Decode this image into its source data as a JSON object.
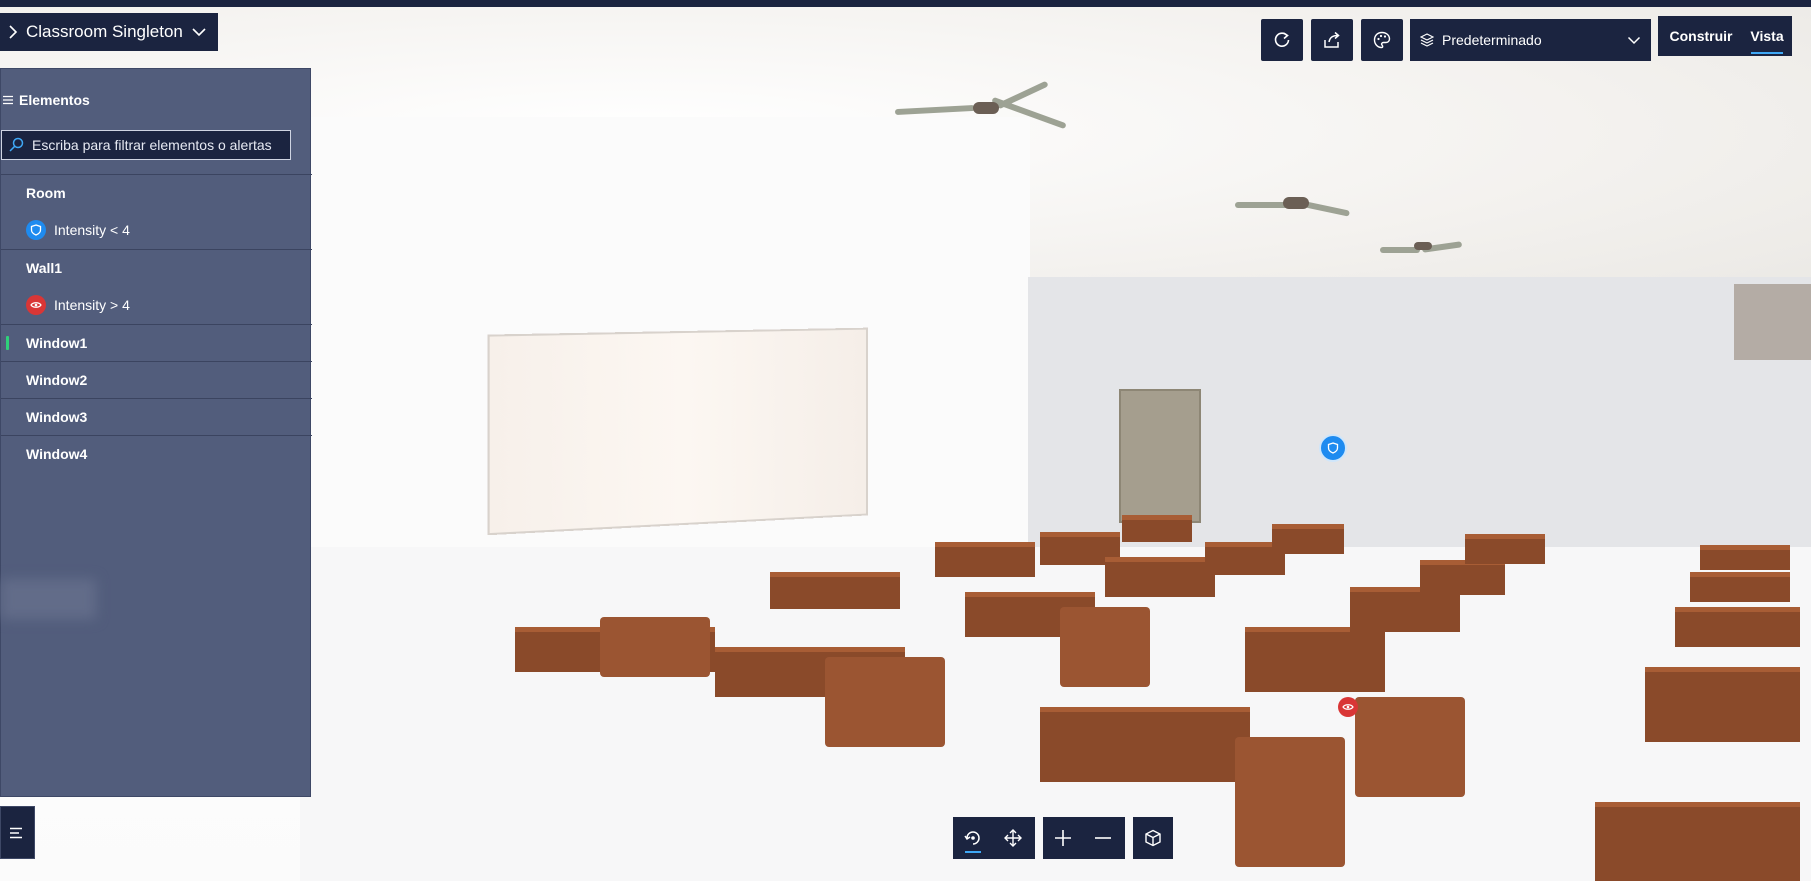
{
  "header": {
    "project_title": "Classroom Singleton"
  },
  "toolbar": {
    "refresh_icon": "refresh-icon",
    "share_icon": "share-icon",
    "theme_icon": "palette-icon",
    "layer_dropdown_value": "Predeterminado",
    "mode_build_label": "Construir",
    "mode_view_label": "Vista",
    "active_mode": "Vista"
  },
  "panel": {
    "title": "Elementos",
    "search_placeholder": "Escriba para filtrar elementos o alertas",
    "groups": [
      {
        "name": "Room",
        "alert": {
          "icon": "shield-icon",
          "text": "Intensity < 4",
          "color": "#1e8bf0"
        }
      },
      {
        "name": "Wall1",
        "alert": {
          "icon": "eye-icon",
          "text": "Intensity > 4",
          "color": "#d93636"
        }
      },
      {
        "name": "Window1",
        "active": true
      },
      {
        "name": "Window2"
      },
      {
        "name": "Window3"
      },
      {
        "name": "Window4"
      }
    ]
  },
  "bottom_nav": {
    "orbit_icon": "orbit-icon",
    "pan_icon": "pan-icon",
    "zoom_in_icon": "zoom-in-icon",
    "zoom_out_icon": "zoom-out-icon",
    "cube_icon": "cube-view-icon",
    "active": "orbit"
  },
  "colors": {
    "dark_navy": "#1b2440",
    "panel_bg": "#525d7c",
    "accent_blue": "#3fa8f5",
    "active_green": "#2fd17a",
    "alert_blue": "#1e8bf0",
    "alert_red": "#d93636"
  }
}
